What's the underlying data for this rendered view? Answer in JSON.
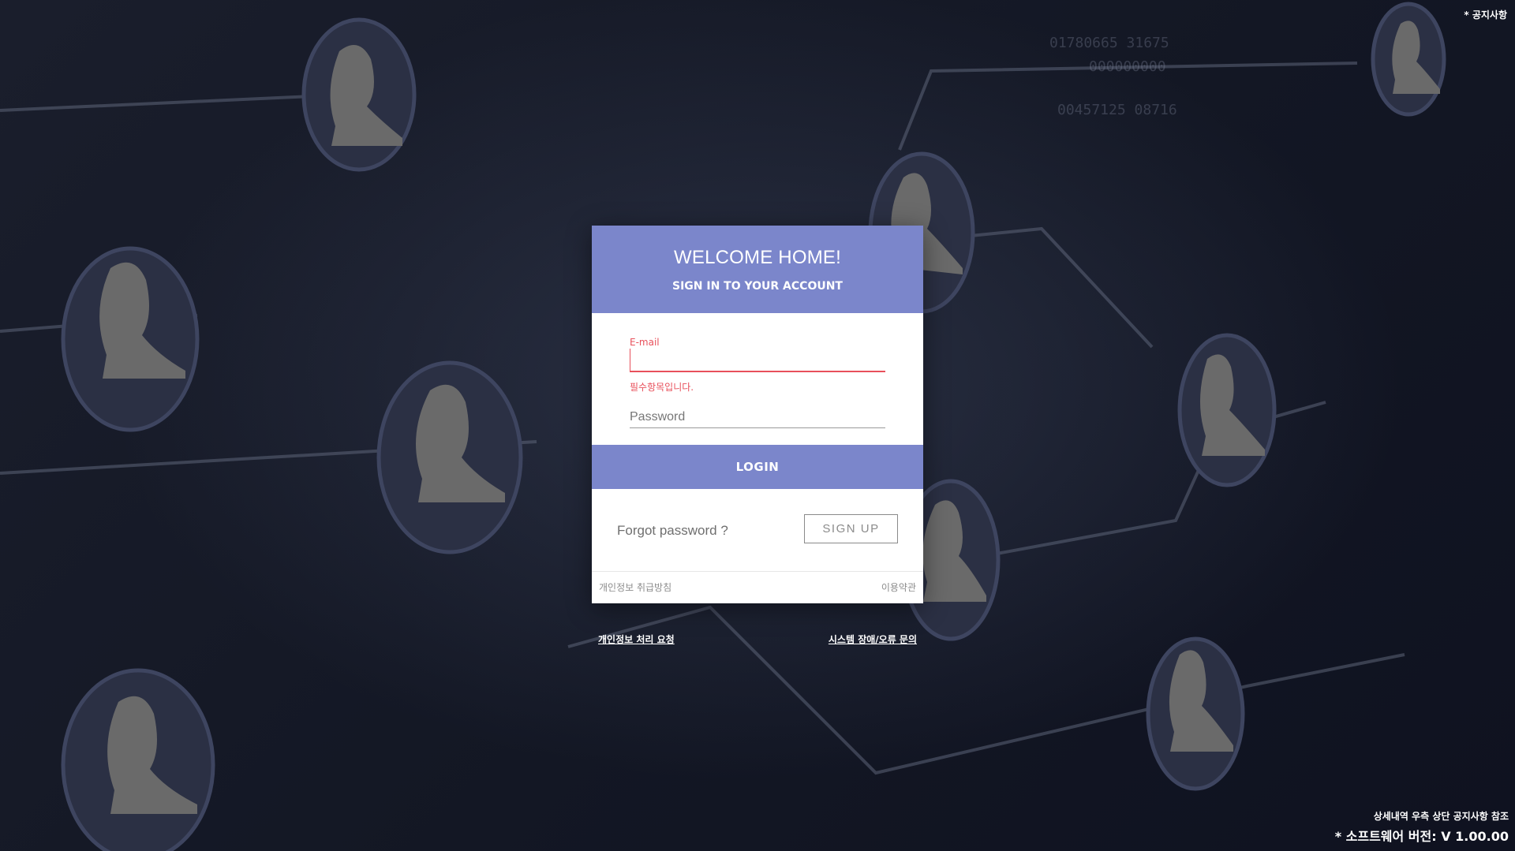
{
  "top_right": {
    "notice_label": "* 공지사항"
  },
  "card": {
    "title": "WELCOME HOME!",
    "subtitle": "SIGN IN TO YOUR ACCOUNT",
    "email": {
      "label": "E-mail",
      "value": "",
      "error": "필수항목입니다."
    },
    "password": {
      "placeholder": "Password"
    },
    "login_label": "LOGIN",
    "forgot_label": "Forgot password ?",
    "signup_label": "SIGN UP",
    "footer": {
      "privacy_policy": "개인정보 취급방침",
      "terms": "이용약관"
    }
  },
  "below_links": {
    "privacy_request": "개인정보 처리 요청",
    "system_inquiry": "시스템 장애/오류 문의"
  },
  "bottom_info": {
    "note": "상세내역 우측 상단 공지사항 참조",
    "version": "* 소프트웨어 버전: V 1.00.00"
  },
  "colors": {
    "accent": "#7b86cb",
    "error": "#e8505b",
    "background": "#161a28"
  }
}
